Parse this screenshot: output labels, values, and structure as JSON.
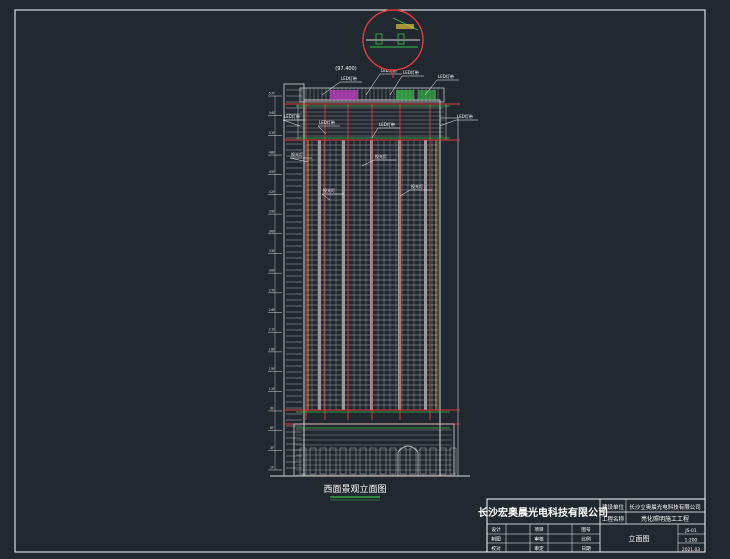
{
  "drawing": {
    "view_title": "西面景观立面图",
    "level_marks_left": [
      "57F",
      "54F",
      "51F",
      "48F",
      "45F",
      "42F",
      "39F",
      "36F",
      "33F",
      "30F",
      "27F",
      "24F",
      "21F",
      "18F",
      "15F",
      "12F",
      "9F",
      "6F",
      "3F",
      "1F"
    ],
    "callouts": [
      "LED灯带",
      "LED灯带",
      "LED灯带",
      "LED灯带",
      "LED灯带",
      "LED灯带",
      "LED灯带",
      "LED灯带",
      "投光灯",
      "投光灯",
      "投光灯",
      "投光灯"
    ],
    "elevation_tag": "(97.400)",
    "colors": {
      "background": "#222830",
      "frame": "#ffffff",
      "building": "#d8d8d8",
      "light_line": "#e23a3a",
      "accent_green": "#36c24a",
      "accent_yellow": "#e0c040",
      "accent_magenta": "#d040d0"
    }
  },
  "title_block": {
    "company": "长沙宏奥晨光电科技有限公司",
    "client_label": "建设单位",
    "client_value": "长沙立奥晨光电科技有限公司",
    "project_label": "工程名称",
    "project_value": "亮化照明施工工程",
    "drawing_name": "立面图",
    "rows": [
      {
        "a": "设计",
        "b": "项目",
        "c": "图号"
      },
      {
        "a": "制图",
        "b": "审核",
        "c": "比例"
      },
      {
        "a": "校对",
        "b": "审定",
        "c": "日期"
      }
    ],
    "row_values": [
      "JS-01",
      "1:200",
      "2021.03"
    ]
  }
}
